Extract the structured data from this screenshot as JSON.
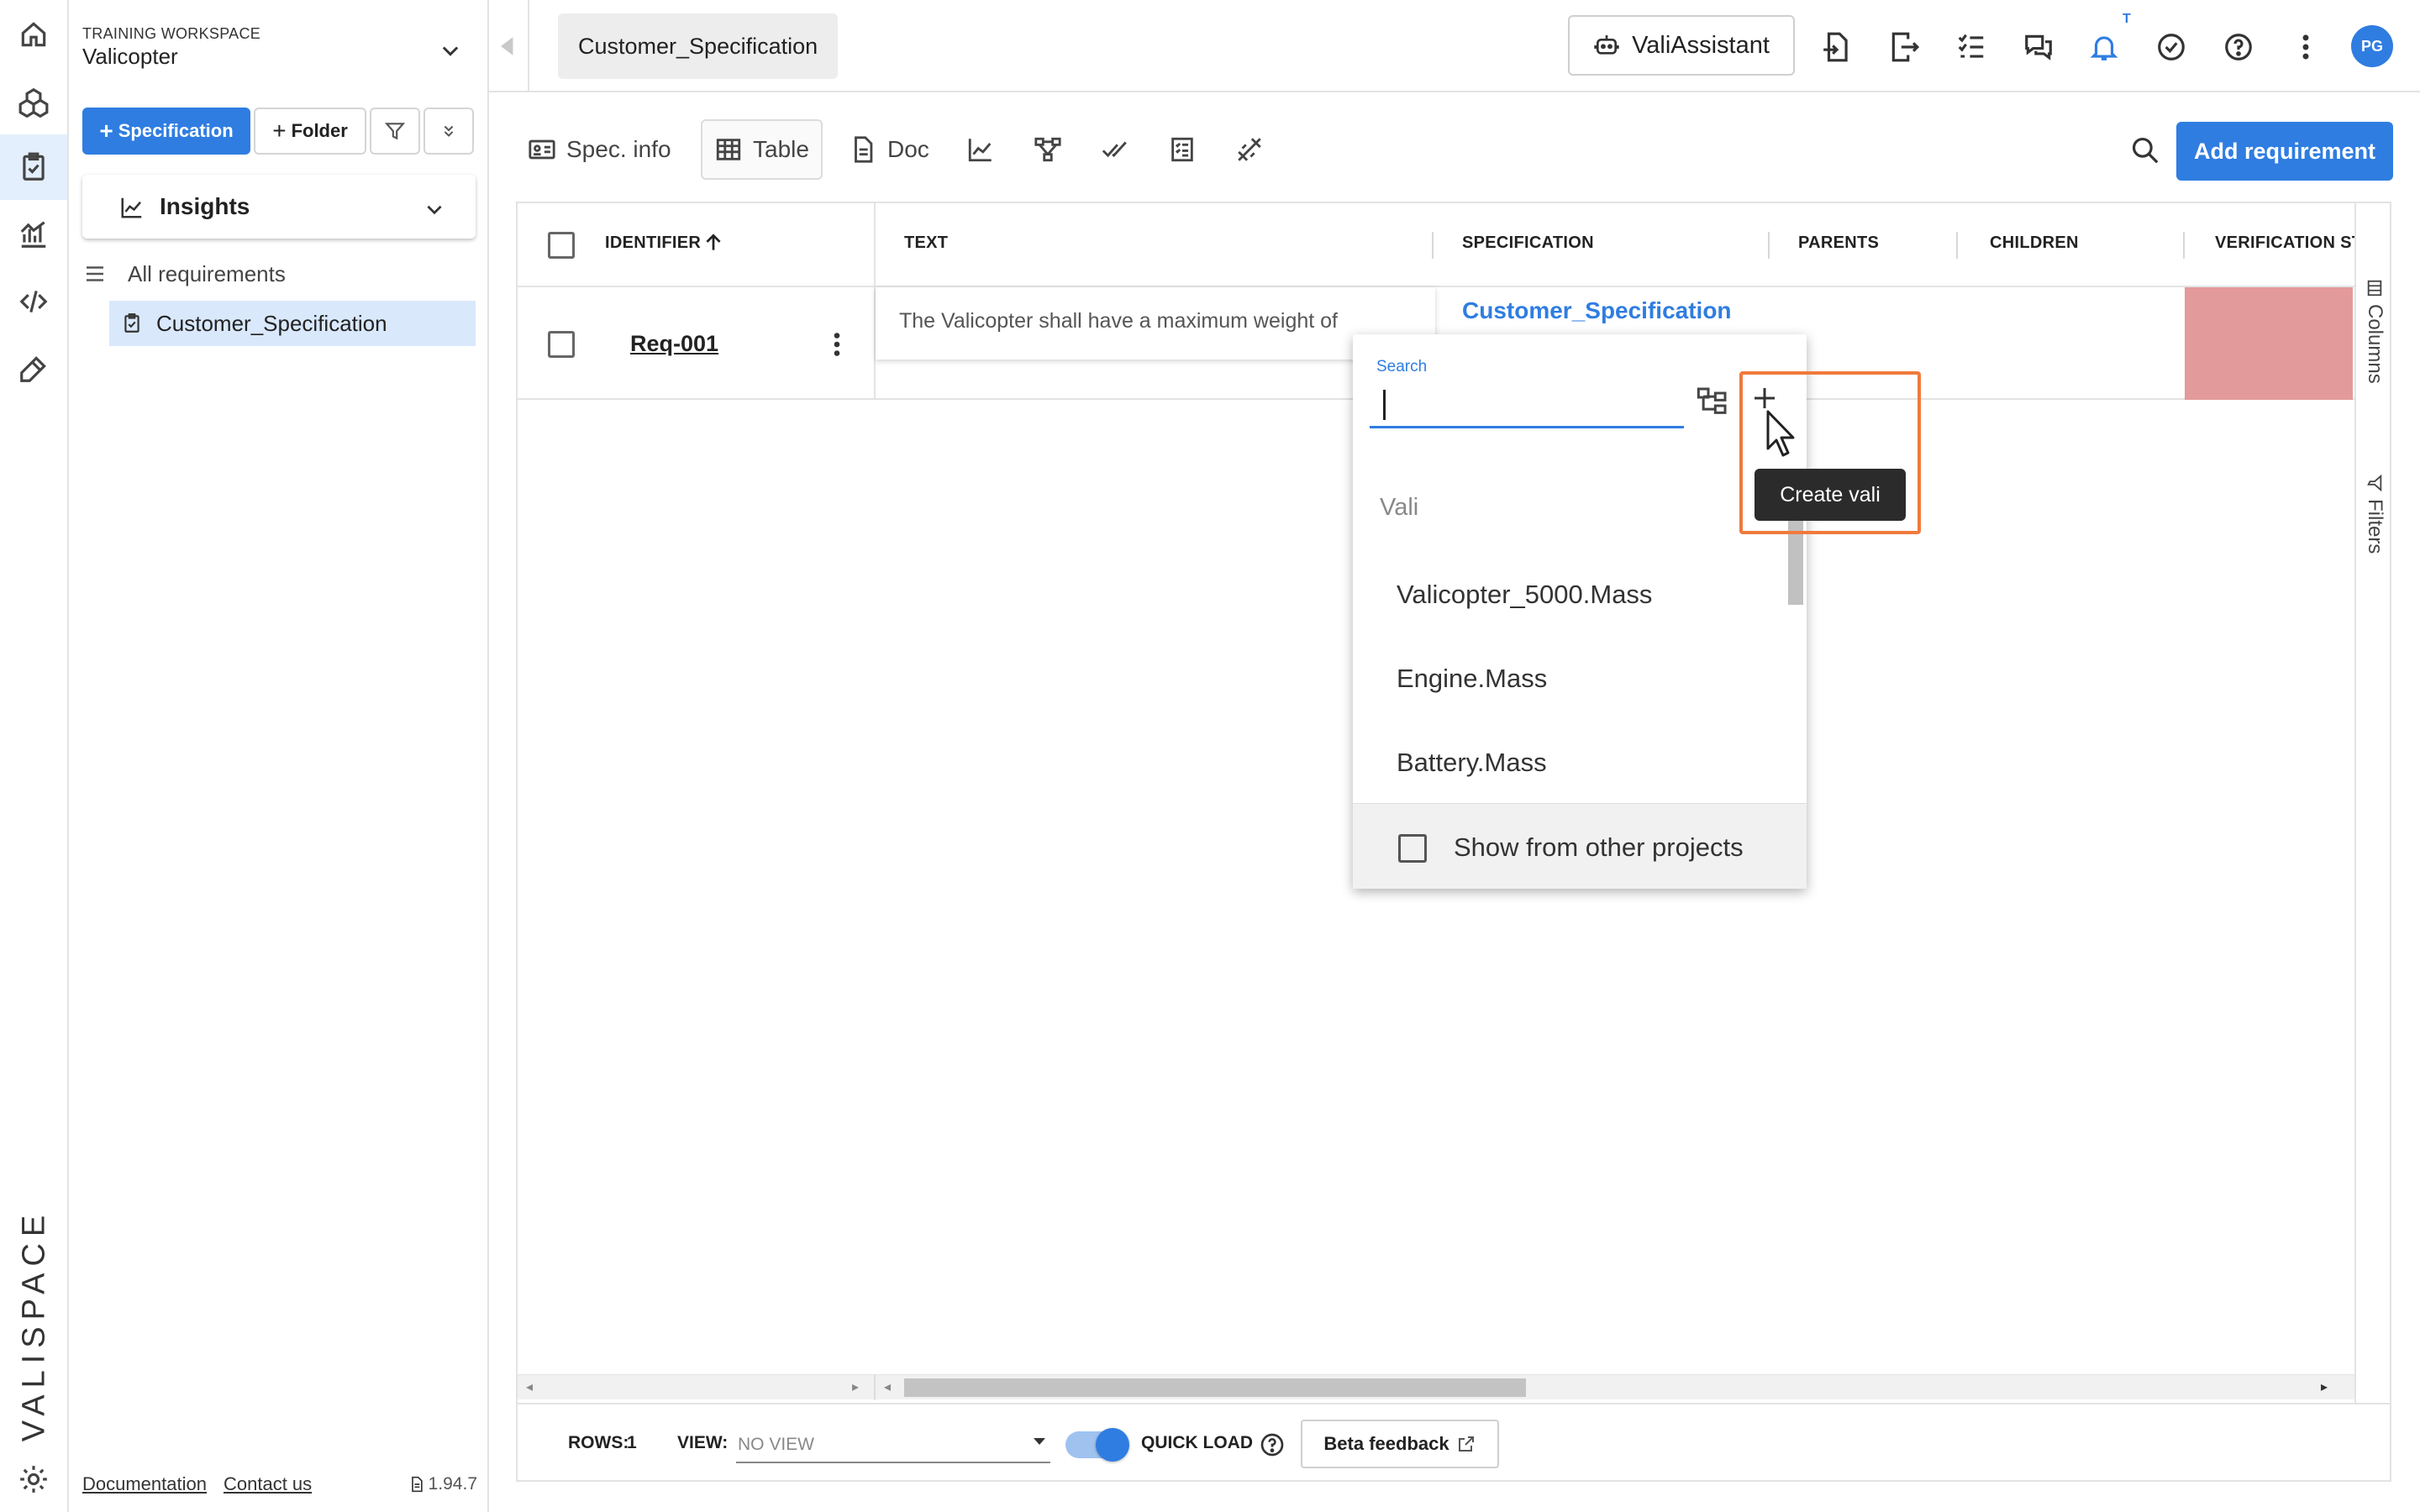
{
  "workspace": {
    "label": "TRAINING WORKSPACE",
    "name": "Valicopter"
  },
  "sidebar": {
    "add_spec_label": "Specification",
    "add_folder_label": "Folder",
    "insights_label": "Insights",
    "tree": {
      "all_label": "All requirements",
      "item_label": "Customer_Specification"
    },
    "footer": {
      "documentation": "Documentation",
      "contact": "Contact us",
      "version": "1.94.7"
    }
  },
  "topbar": {
    "tab_label": "Customer_Specification",
    "assistant_label": "ValiAssistant",
    "notification_badge": "T",
    "avatar_initials": "PG"
  },
  "toolbar": {
    "tools": {
      "spec_info": "Spec. info",
      "table": "Table",
      "doc": "Doc"
    },
    "add_requirement": "Add requirement"
  },
  "table": {
    "headers": {
      "identifier": "IDENTIFIER",
      "text": "TEXT",
      "specification": "SPECIFICATION",
      "parents": "PARENTS",
      "children": "CHILDREN",
      "verification": "VERIFICATION ST"
    },
    "rows": [
      {
        "identifier": "Req-001",
        "text": "The Valicopter shall have a maximum weight of",
        "specification": "Customer_Specification"
      }
    ],
    "side_tabs": {
      "columns": "Columns",
      "filters": "Filters"
    }
  },
  "footer": {
    "rows_label": "ROWS:",
    "rows_value": "1",
    "view_label": "VIEW:",
    "view_placeholder": "NO VIEW",
    "quick_load_label": "QUICK LOAD",
    "quick_load_on": true,
    "beta_feedback": "Beta feedback"
  },
  "dropdown": {
    "search_label": "Search",
    "search_value": "",
    "group_label": "Vali",
    "items": [
      "Valicopter_5000.Mass",
      "Engine.Mass",
      "Battery.Mass"
    ],
    "show_other_projects": "Show from other projects",
    "tooltip": "Create vali"
  },
  "brand": {
    "logo_text": "VALISPACE",
    "accent_color": "#2f7de1",
    "highlight_color": "#f07a3c",
    "verification_color": "#e39a9a"
  }
}
